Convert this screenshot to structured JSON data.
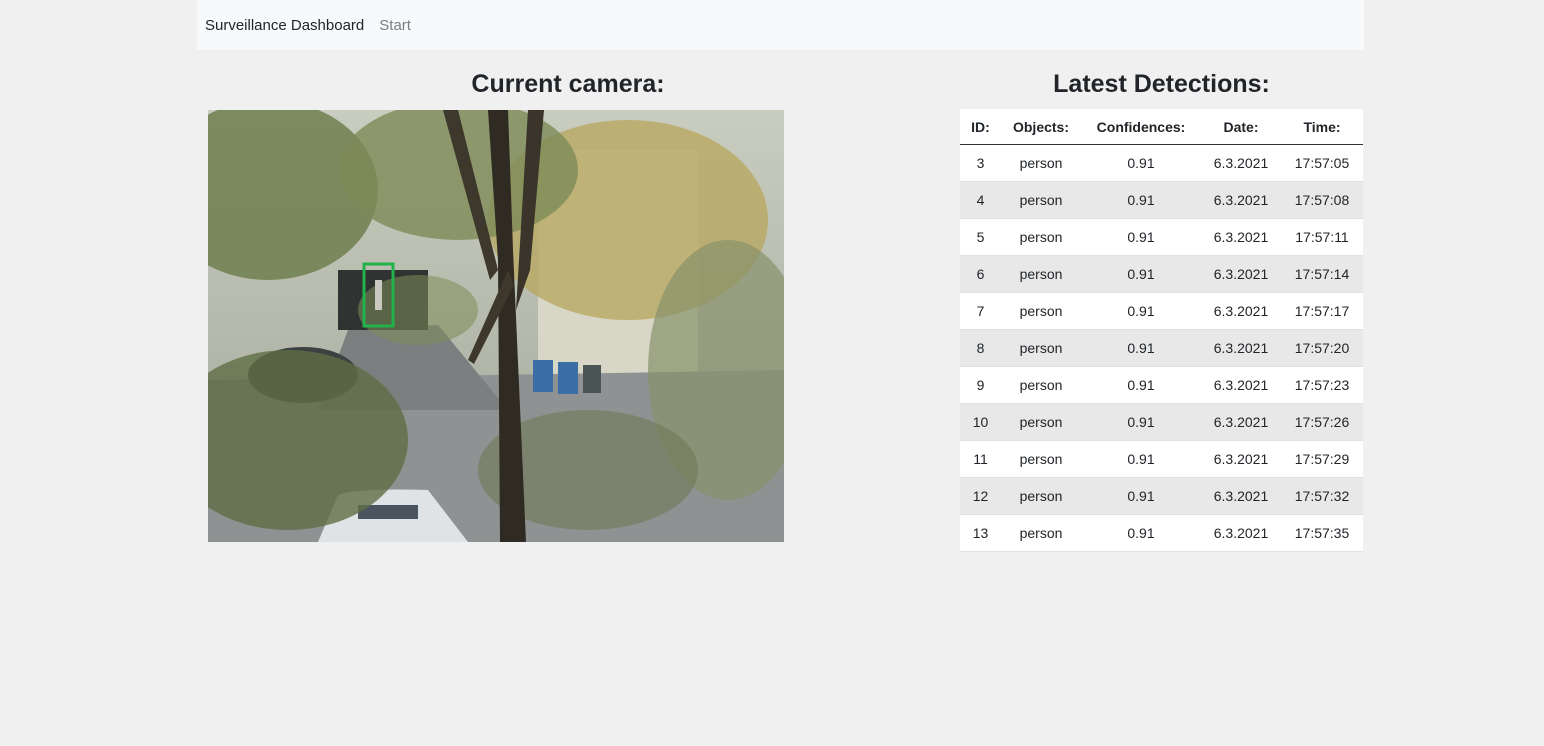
{
  "navbar": {
    "brand": "Surveillance Dashboard",
    "links": [
      "Start"
    ]
  },
  "camera_panel": {
    "title": "Current camera:",
    "detection_box_color": "#22b24c"
  },
  "detections_panel": {
    "title": "Latest Detections:",
    "columns": [
      "ID:",
      "Objects:",
      "Confidences:",
      "Date:",
      "Time:"
    ],
    "rows": [
      [
        "3",
        "person",
        "0.91",
        "6.3.2021",
        "17:57:05"
      ],
      [
        "4",
        "person",
        "0.91",
        "6.3.2021",
        "17:57:08"
      ],
      [
        "5",
        "person",
        "0.91",
        "6.3.2021",
        "17:57:11"
      ],
      [
        "6",
        "person",
        "0.91",
        "6.3.2021",
        "17:57:14"
      ],
      [
        "7",
        "person",
        "0.91",
        "6.3.2021",
        "17:57:17"
      ],
      [
        "8",
        "person",
        "0.91",
        "6.3.2021",
        "17:57:20"
      ],
      [
        "9",
        "person",
        "0.91",
        "6.3.2021",
        "17:57:23"
      ],
      [
        "10",
        "person",
        "0.91",
        "6.3.2021",
        "17:57:26"
      ],
      [
        "11",
        "person",
        "0.91",
        "6.3.2021",
        "17:57:29"
      ],
      [
        "12",
        "person",
        "0.91",
        "6.3.2021",
        "17:57:32"
      ],
      [
        "13",
        "person",
        "0.91",
        "6.3.2021",
        "17:57:35"
      ]
    ]
  }
}
